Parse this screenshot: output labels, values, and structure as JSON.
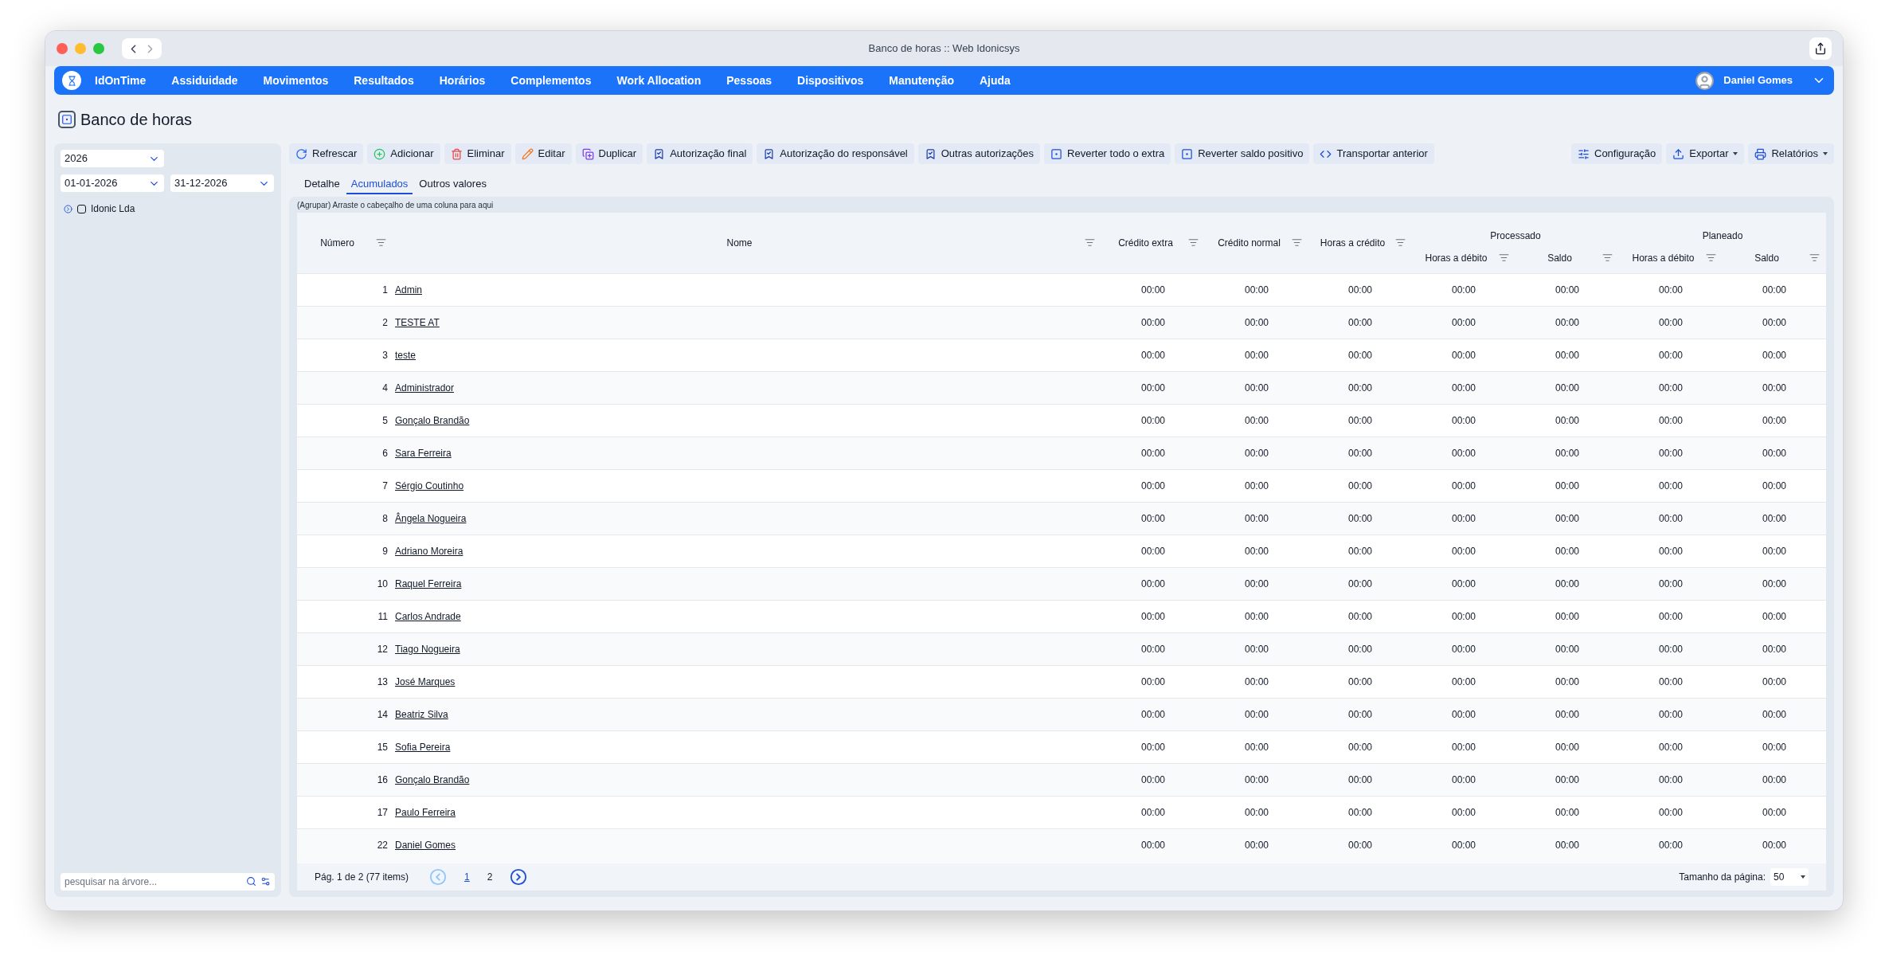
{
  "window": {
    "title": "Banco de horas :: Web Idonicsys"
  },
  "navbar": {
    "brand": "IdOnTime",
    "items": [
      "Assiduidade",
      "Movimentos",
      "Resultados",
      "Horários",
      "Complementos",
      "Work Allocation",
      "Pessoas",
      "Dispositivos",
      "Manutenção",
      "Ajuda"
    ],
    "user": "Daniel Gomes"
  },
  "page_title": "Banco de horas",
  "sidebar": {
    "year": "2026",
    "date_from": "01-01-2026",
    "date_to": "31-12-2026",
    "tree": [
      {
        "label": "Idonic Lda",
        "checked": false,
        "expanded": false
      }
    ],
    "search": {
      "placeholder": "pesquisar na árvore..."
    }
  },
  "toolbar": {
    "actions": [
      {
        "label": "Refrescar"
      },
      {
        "label": "Adicionar"
      },
      {
        "label": "Eliminar"
      },
      {
        "label": "Editar"
      },
      {
        "label": "Duplicar"
      },
      {
        "label": "Autorização final"
      },
      {
        "label": "Autorização do responsável"
      },
      {
        "label": "Outras autorizações"
      },
      {
        "label": "Reverter todo o extra"
      },
      {
        "label": "Reverter saldo positivo"
      },
      {
        "label": "Transportar anterior"
      }
    ],
    "right_actions": [
      {
        "label": "Configuração",
        "dropdown": false
      },
      {
        "label": "Exportar",
        "dropdown": true
      },
      {
        "label": "Relatórios",
        "dropdown": true
      }
    ]
  },
  "tabs": [
    {
      "label": "Detalhe",
      "selected": false
    },
    {
      "label": "Acumulados",
      "selected": true
    },
    {
      "label": "Outros valores",
      "selected": false
    }
  ],
  "grid": {
    "group_hint": "(Agrupar) Arraste o cabeçalho de uma coluna para aqui",
    "columns": [
      "Número",
      "Nome",
      "Crédito extra",
      "Crédito normal",
      "Horas a crédito"
    ],
    "column_groups": [
      {
        "label": "Processado",
        "columns": [
          "Horas a débito",
          "Saldo"
        ]
      },
      {
        "label": "Planeado",
        "columns": [
          "Horas a débito",
          "Saldo"
        ]
      }
    ],
    "rows": [
      {
        "numero": "1",
        "nome": "Admin",
        "values": [
          "00:00",
          "00:00",
          "00:00",
          "00:00",
          "00:00",
          "00:00",
          "00:00"
        ]
      },
      {
        "numero": "2",
        "nome": "TESTE AT",
        "values": [
          "00:00",
          "00:00",
          "00:00",
          "00:00",
          "00:00",
          "00:00",
          "00:00"
        ]
      },
      {
        "numero": "3",
        "nome": "teste",
        "values": [
          "00:00",
          "00:00",
          "00:00",
          "00:00",
          "00:00",
          "00:00",
          "00:00"
        ]
      },
      {
        "numero": "4",
        "nome": "Administrador",
        "values": [
          "00:00",
          "00:00",
          "00:00",
          "00:00",
          "00:00",
          "00:00",
          "00:00"
        ]
      },
      {
        "numero": "5",
        "nome": "Gonçalo Brandão",
        "values": [
          "00:00",
          "00:00",
          "00:00",
          "00:00",
          "00:00",
          "00:00",
          "00:00"
        ]
      },
      {
        "numero": "6",
        "nome": "Sara Ferreira",
        "values": [
          "00:00",
          "00:00",
          "00:00",
          "00:00",
          "00:00",
          "00:00",
          "00:00"
        ]
      },
      {
        "numero": "7",
        "nome": "Sérgio Coutinho",
        "values": [
          "00:00",
          "00:00",
          "00:00",
          "00:00",
          "00:00",
          "00:00",
          "00:00"
        ]
      },
      {
        "numero": "8",
        "nome": "Ângela Nogueira",
        "values": [
          "00:00",
          "00:00",
          "00:00",
          "00:00",
          "00:00",
          "00:00",
          "00:00"
        ]
      },
      {
        "numero": "9",
        "nome": "Adriano Moreira",
        "values": [
          "00:00",
          "00:00",
          "00:00",
          "00:00",
          "00:00",
          "00:00",
          "00:00"
        ]
      },
      {
        "numero": "10",
        "nome": "Raquel Ferreira",
        "values": [
          "00:00",
          "00:00",
          "00:00",
          "00:00",
          "00:00",
          "00:00",
          "00:00"
        ]
      },
      {
        "numero": "11",
        "nome": "Carlos Andrade",
        "values": [
          "00:00",
          "00:00",
          "00:00",
          "00:00",
          "00:00",
          "00:00",
          "00:00"
        ]
      },
      {
        "numero": "12",
        "nome": "Tiago Nogueira",
        "values": [
          "00:00",
          "00:00",
          "00:00",
          "00:00",
          "00:00",
          "00:00",
          "00:00"
        ]
      },
      {
        "numero": "13",
        "nome": "José Marques",
        "values": [
          "00:00",
          "00:00",
          "00:00",
          "00:00",
          "00:00",
          "00:00",
          "00:00"
        ]
      },
      {
        "numero": "14",
        "nome": "Beatriz Silva",
        "values": [
          "00:00",
          "00:00",
          "00:00",
          "00:00",
          "00:00",
          "00:00",
          "00:00"
        ]
      },
      {
        "numero": "15",
        "nome": "Sofia Pereira",
        "values": [
          "00:00",
          "00:00",
          "00:00",
          "00:00",
          "00:00",
          "00:00",
          "00:00"
        ]
      },
      {
        "numero": "16",
        "nome": "Gonçalo Brandão",
        "values": [
          "00:00",
          "00:00",
          "00:00",
          "00:00",
          "00:00",
          "00:00",
          "00:00"
        ]
      },
      {
        "numero": "17",
        "nome": "Paulo Ferreira",
        "values": [
          "00:00",
          "00:00",
          "00:00",
          "00:00",
          "00:00",
          "00:00",
          "00:00"
        ]
      },
      {
        "numero": "22",
        "nome": "Daniel Gomes",
        "values": [
          "00:00",
          "00:00",
          "00:00",
          "00:00",
          "00:00",
          "00:00",
          "00:00"
        ]
      }
    ]
  },
  "pager": {
    "summary": "Pág. 1 de 2 (77 items)",
    "pages": [
      {
        "label": "1",
        "selected": true
      },
      {
        "label": "2",
        "selected": false
      }
    ],
    "page_size_label": "Tamanho da página:",
    "page_size": "50"
  }
}
